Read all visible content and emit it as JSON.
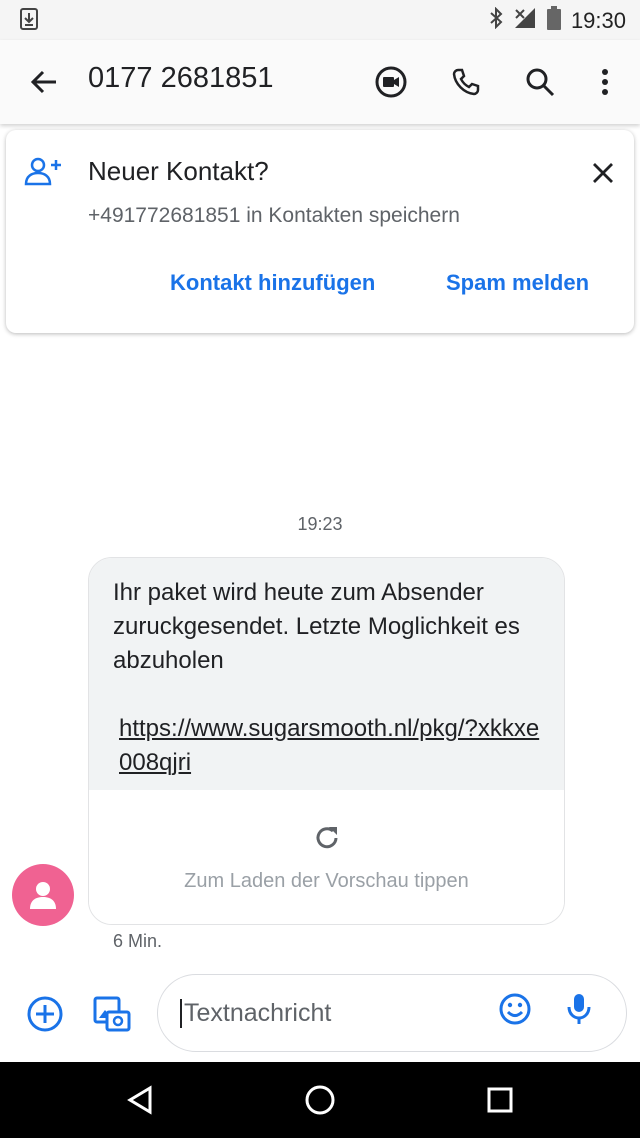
{
  "status_bar": {
    "time": "19:30",
    "icons": [
      "download-icon",
      "bluetooth-icon",
      "no-signal-icon",
      "battery-icon"
    ]
  },
  "header": {
    "title": "0177 2681851",
    "actions": [
      "video-call-icon",
      "phone-icon",
      "search-icon",
      "more-vert-icon"
    ]
  },
  "contact_card": {
    "title": "Neuer Kontakt?",
    "subtitle": "+491772681851 in Kontakten speichern",
    "add_contact_label": "Kontakt hinzufügen",
    "report_spam_label": "Spam melden"
  },
  "conversation": {
    "timestamp": "19:23",
    "message": {
      "text": "Ihr paket wird heute zum Absender zuruckgesendet. Letzte Moglichkeit es abzuholen",
      "link": "https://www.sugarsmooth.nl/pkg/?xkkxe008qjri",
      "preview_hint": "Zum Laden der Vorschau tippen",
      "age": "6 Min."
    }
  },
  "compose": {
    "placeholder": "Textnachricht"
  },
  "colors": {
    "accent": "#1a73e8",
    "avatar": "#f06292",
    "bubble": "#f1f3f4"
  }
}
